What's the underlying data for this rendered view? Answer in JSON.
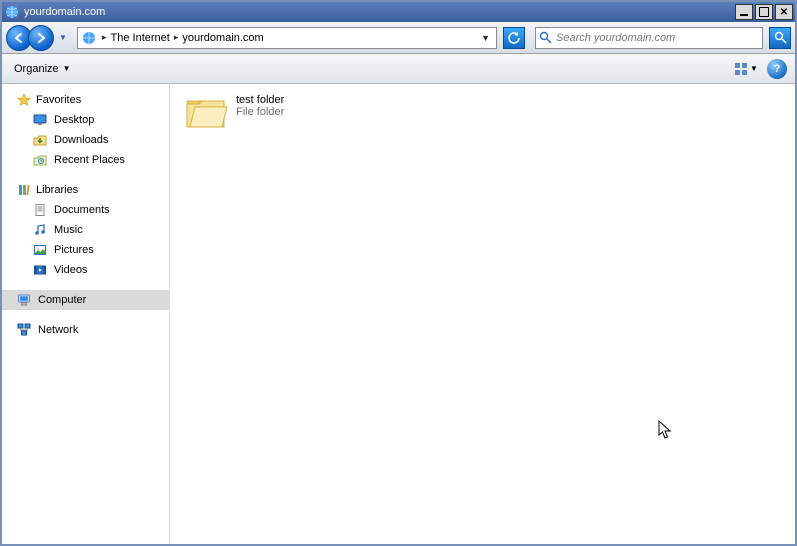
{
  "window": {
    "title": "yourdomain.com"
  },
  "nav": {
    "breadcrumb": [
      "The Internet",
      "yourdomain.com"
    ],
    "search_placeholder": "Search yourdomain.com"
  },
  "toolbar": {
    "organize_label": "Organize"
  },
  "sidebar": {
    "favorites": {
      "label": "Favorites",
      "items": [
        {
          "icon": "desktop-icon",
          "label": "Desktop"
        },
        {
          "icon": "downloads-icon",
          "label": "Downloads"
        },
        {
          "icon": "recent-places-icon",
          "label": "Recent Places"
        }
      ]
    },
    "libraries": {
      "label": "Libraries",
      "items": [
        {
          "icon": "documents-icon",
          "label": "Documents"
        },
        {
          "icon": "music-icon",
          "label": "Music"
        },
        {
          "icon": "pictures-icon",
          "label": "Pictures"
        },
        {
          "icon": "videos-icon",
          "label": "Videos"
        }
      ]
    },
    "computer": {
      "label": "Computer",
      "selected": true
    },
    "network": {
      "label": "Network"
    }
  },
  "content": {
    "items": [
      {
        "name": "test folder",
        "type_label": "File folder"
      }
    ]
  }
}
